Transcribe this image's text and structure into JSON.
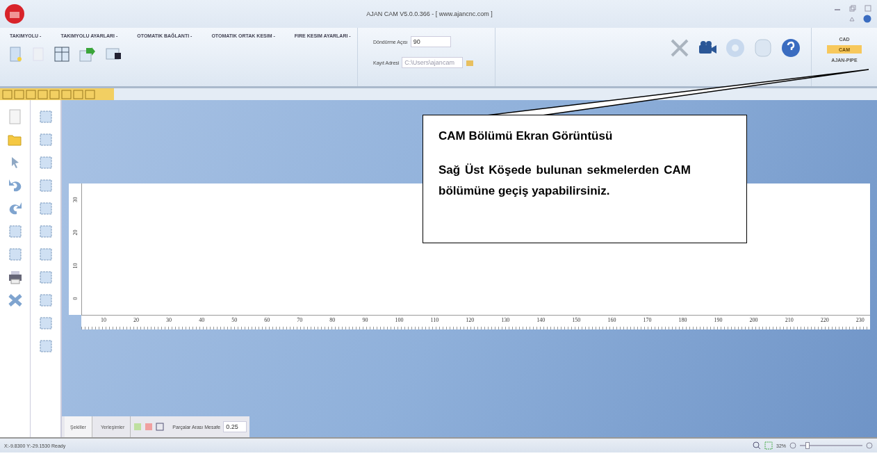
{
  "window": {
    "title": "AJAN CAM V5.0.0.366 - [ www.ajancnc.com ]"
  },
  "ribbon": {
    "menus": [
      {
        "label": "TAKIMYOLU -"
      },
      {
        "label": "TAKIMYOLU AYARLARI -"
      },
      {
        "label": "OTOMATIK BAĞLANTI -"
      },
      {
        "label": "OTOMATIK ORTAK KESIM -"
      },
      {
        "label": "FIRE KESIM AYARLARI -"
      }
    ],
    "fields": [
      {
        "label": "Döndürme Açısı",
        "value": "90"
      },
      {
        "label": "Kayıt Adresi",
        "placeholder": "C:\\Users\\ajancam"
      }
    ],
    "modes": [
      {
        "label": "CAD",
        "selected": false
      },
      {
        "label": "CAM",
        "selected": true
      },
      {
        "label": "AJAN-PIPE",
        "selected": false
      }
    ]
  },
  "ruler": {
    "x_labels": [
      "10",
      "20",
      "30",
      "40",
      "50",
      "60",
      "70",
      "80",
      "90",
      "100",
      "110",
      "120",
      "130",
      "140",
      "150",
      "160",
      "170",
      "180",
      "190",
      "200",
      "210",
      "220",
      "230"
    ],
    "y_labels": [
      "30",
      "20",
      "10",
      "0"
    ]
  },
  "callout": {
    "title": "CAM Bölümü Ekran Görüntüsü",
    "text": "Sağ Üst Köşede bulunan sekmelerden CAM bölümüne geçiş yapabilirsiniz."
  },
  "bottom_tabs": [
    {
      "label": "Şekiller",
      "selected": true
    },
    {
      "label": "Yerleşimler",
      "selected": false
    }
  ],
  "spacing": {
    "label": "Parçalar Arası Mesafe",
    "value": "0.25"
  },
  "status_bar": {
    "text": "X:-9.8300 Y:-29.1530  Ready",
    "zoom": "32%",
    "zoom_slider": {
      "level": 0.1
    }
  }
}
